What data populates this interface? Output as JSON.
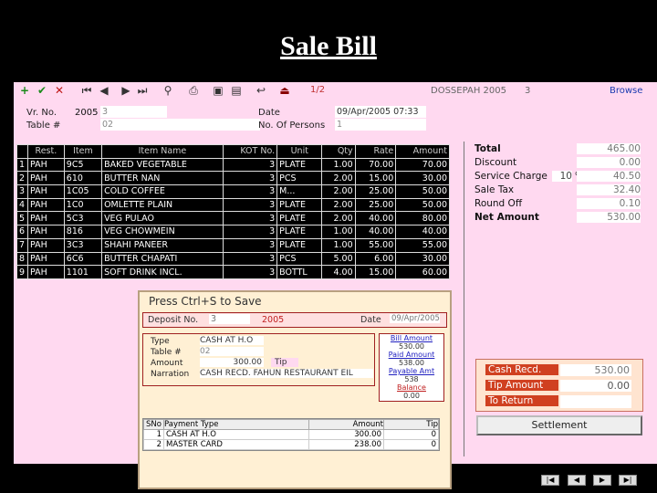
{
  "slide_title": "Sale Bill",
  "header": {
    "counter": "1/2",
    "company": "DOSSEPAH 2005",
    "company_no": "3",
    "browse": "Browse",
    "vr_no_label": "Vr. No.",
    "vr_year": "2005",
    "vr_no": "3",
    "table_label": "Table #",
    "table_value": "02",
    "date_label": "Date",
    "date_value": "09/Apr/2005 07:33",
    "persons_label": "No. Of Persons",
    "persons_value": "1"
  },
  "grid": {
    "headers": [
      "",
      "Rest.",
      "Item",
      "Item Name",
      "KOT No.",
      "Unit",
      "Qty",
      "Rate",
      "Amount"
    ],
    "rows": [
      [
        "1",
        "PAH",
        "9C5",
        "BAKED VEGETABLE",
        "3",
        "PLATE",
        "1.00",
        "70.00",
        "70.00"
      ],
      [
        "2",
        "PAH",
        "610",
        "BUTTER NAN",
        "3",
        "PCS",
        "2.00",
        "15.00",
        "30.00"
      ],
      [
        "3",
        "PAH",
        "1C05",
        "COLD COFFEE",
        "3",
        "M...",
        "2.00",
        "25.00",
        "50.00"
      ],
      [
        "4",
        "PAH",
        "1C0",
        "OMLETTE PLAIN",
        "3",
        "PLATE",
        "2.00",
        "25.00",
        "50.00"
      ],
      [
        "5",
        "PAH",
        "5C3",
        "VEG PULAO",
        "3",
        "PLATE",
        "2.00",
        "40.00",
        "80.00"
      ],
      [
        "6",
        "PAH",
        "816",
        "VEG CHOWMEIN",
        "3",
        "PLATE",
        "1.00",
        "40.00",
        "40.00"
      ],
      [
        "7",
        "PAH",
        "3C3",
        "SHAHI PANEER",
        "3",
        "PLATE",
        "1.00",
        "55.00",
        "55.00"
      ],
      [
        "8",
        "PAH",
        "6C6",
        "BUTTER CHAPATI",
        "3",
        "PCS",
        "5.00",
        "6.00",
        "30.00"
      ],
      [
        "9",
        "PAH",
        "1101",
        "SOFT DRINK INCL.",
        "3",
        "BOTTL",
        "4.00",
        "15.00",
        "60.00"
      ]
    ]
  },
  "totals": {
    "total_label": "Total",
    "total": "465.00",
    "discount_label": "Discount",
    "discount": "0.00",
    "service_label": "Service Charge",
    "service_pct": "10",
    "pct_sign": "%",
    "service": "40.50",
    "sale_tax_label": "Sale Tax",
    "sale_tax": "32.40",
    "round_label": "Round Off",
    "round": "0.10",
    "net_label": "Net Amount",
    "net": "530.00"
  },
  "payment": {
    "cash_recd_label": "Cash Recd.",
    "cash_recd": "530.00",
    "tip_label": "Tip Amount",
    "tip": "0.00",
    "return_label": "To Return",
    "return": "",
    "settle_label": "Settlement"
  },
  "dialog": {
    "title": "Press Ctrl+S to Save",
    "deposit_label": "Deposit No.",
    "deposit_no": "3",
    "deposit_year": "2005",
    "date_label": "Date",
    "date": "09/Apr/2005",
    "type_label": "Type",
    "type": "CASH AT H.O",
    "table_label": "Table #",
    "table": "02",
    "amount_label": "Amount",
    "amount": "300.00",
    "tip_label": "Tip",
    "narration_label": "Narration",
    "narration": "CASH RECD. FAHUN RESTAURANT EIL",
    "bill_amount_label": "Bill Amount",
    "bill_amount": "530.00",
    "paid_amount_label": "Paid Amount",
    "paid_amount": "538.00",
    "payable_label": "Payable Amt",
    "payable": "538",
    "balance_label": "Balance",
    "balance": "0.00",
    "table_headers": [
      "SNo",
      "Payment Type",
      "Amount",
      "Tip"
    ],
    "rows": [
      [
        "1",
        "CASH AT H.O",
        "300.00",
        "0"
      ],
      [
        "2",
        "MASTER CARD",
        "238.00",
        "0"
      ]
    ]
  }
}
